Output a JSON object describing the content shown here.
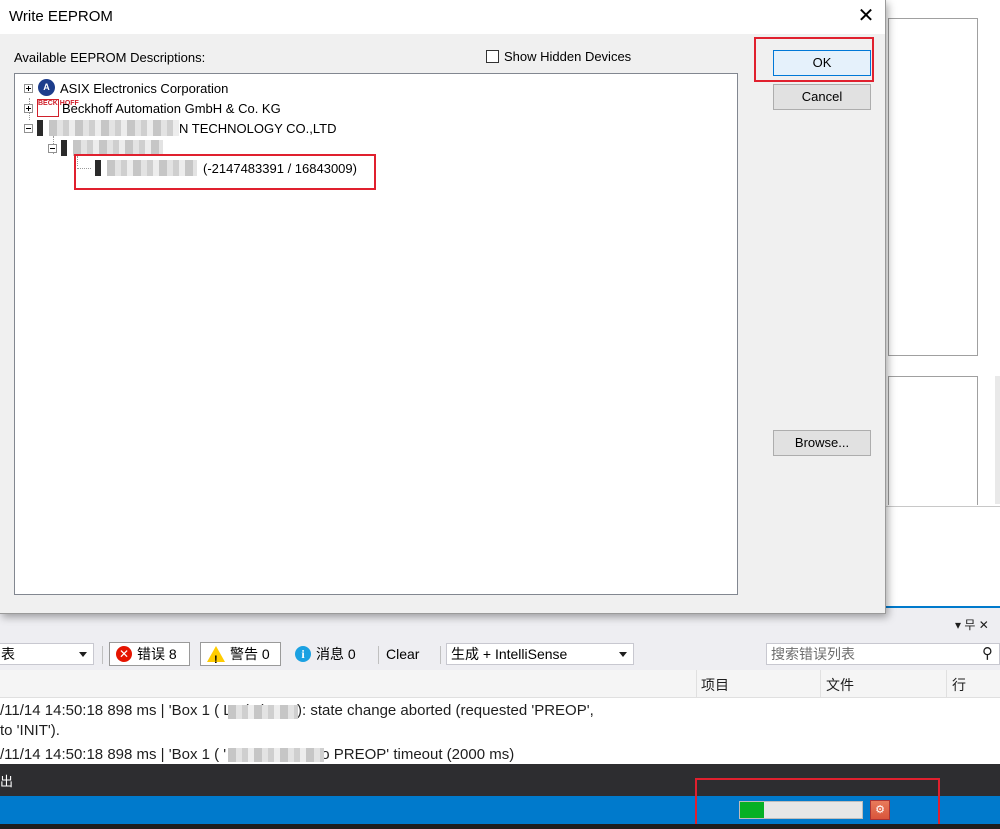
{
  "dialog": {
    "title": "Write EEPROM",
    "close_glyph": "✕",
    "available_label": "Available EEPROM Descriptions:",
    "show_hidden_label": "Show Hidden Devices",
    "ok_label": "OK",
    "cancel_label": "Cancel",
    "browse_label": "Browse...",
    "tree": [
      {
        "label": "ASIX Electronics Corporation",
        "icon": "asix-logo-icon",
        "icon_text": "A"
      },
      {
        "label": "Beckhoff Automation GmbH & Co. KG",
        "icon": "beckhoff-logo-icon",
        "icon_text": "BECK HOFF"
      },
      {
        "label": "N TECHNOLOGY CO.,LTD",
        "icon": "device-icon"
      },
      {
        "label": "(-2147483391 / 16843009)",
        "icon": "device-icon"
      }
    ]
  },
  "error_list": {
    "errors_label": "错误 8",
    "warnings_label": "警告 0",
    "messages_label": "消息 0",
    "clear_label": "Clear",
    "filter_value": "生成 + IntelliSense",
    "search_placeholder": "搜索错误列表",
    "scope_partial": "表",
    "title_controls": "▾ 무 ✕",
    "columns": {
      "project": "项目",
      "file": "文件",
      "line": "行"
    },
    "lines": [
      "/11/14 14:50:18 898 ms | 'Box 1 (           LIC)' (1001): state change aborted (requested 'PREOP',",
      " to 'INIT').",
      "/11/14 14:50:18 898 ms | 'Box 1 (              ' (1001): 'INIT to PREOP' timeout (2000 ms)"
    ]
  },
  "dark_bar_text": "出",
  "status": {
    "progress_fraction": 0.2
  }
}
